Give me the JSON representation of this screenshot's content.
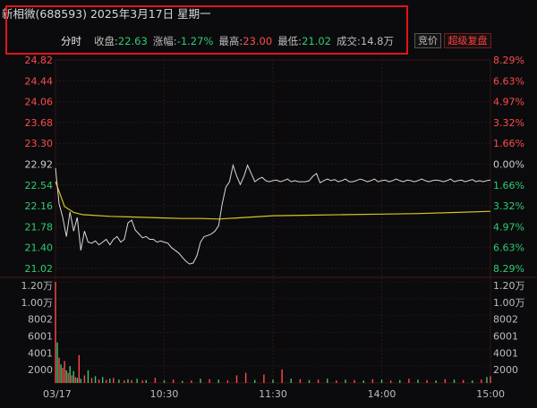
{
  "header": {
    "title": "新相微(688593) 2025年3月17日 星期一",
    "mode": "分时",
    "close_label": "收盘:",
    "close_value": "22.63",
    "change_label": "涨幅:",
    "change_value": "-1.27%",
    "high_label": "最高:",
    "high_value": "23.00",
    "low_label": "最低:",
    "low_value": "21.02",
    "volume_label": "成交:",
    "volume_value": "14.8万"
  },
  "buttons": {
    "bid_label": "竞价",
    "super_label": "超级复盘"
  },
  "colors": {
    "up": "#ff4b4b",
    "down": "#2ecc71",
    "price_line": "#d8d8d8",
    "avg_line": "#d7c51e",
    "highlight_box": "#e0141b"
  },
  "chart_data": {
    "type": "line",
    "price_axis": {
      "ticks": [
        "24.82",
        "24.44",
        "24.06",
        "23.68",
        "23.30",
        "22.92",
        "22.54",
        "22.16",
        "21.78",
        "21.40",
        "21.02"
      ],
      "ylim": [
        21.02,
        24.82
      ],
      "prev_close": 22.92
    },
    "pct_axis": {
      "ticks": [
        "8.29%",
        "6.63%",
        "4.97%",
        "3.32%",
        "1.66%",
        "0.00%",
        "1.66%",
        "3.32%",
        "4.97%",
        "6.63%",
        "8.29%"
      ]
    },
    "x_ticks": [
      "03/17",
      "10:30",
      "11:30",
      "14:00",
      "15:00"
    ],
    "price_series": {
      "x": [
        0,
        2,
        4,
        6,
        8,
        10,
        12,
        14,
        16,
        18,
        20,
        22,
        24,
        26,
        28,
        30,
        32,
        34,
        36,
        38,
        40,
        42,
        44,
        46,
        48,
        50,
        52,
        54,
        56,
        58,
        60,
        62,
        64,
        66,
        68,
        70,
        72,
        74,
        76,
        78,
        80,
        82,
        84,
        86,
        88,
        90,
        92,
        94,
        96,
        98,
        100,
        102,
        104,
        106,
        108,
        110,
        112,
        114,
        116,
        118,
        120,
        122,
        124,
        126,
        128,
        130,
        132,
        134,
        136,
        138,
        140,
        142,
        144,
        146,
        148,
        150,
        152,
        154,
        156,
        158,
        160,
        162,
        164,
        166,
        168,
        170,
        172,
        174,
        176,
        178,
        180,
        182,
        184,
        186,
        188,
        190,
        192,
        194,
        196,
        198,
        200,
        202,
        204,
        206,
        208,
        210,
        212,
        214,
        216,
        218,
        220,
        222,
        224,
        226,
        228,
        230,
        232,
        234,
        236,
        238,
        240
      ],
      "values": [
        22.85,
        22.2,
        21.95,
        21.6,
        22.05,
        21.7,
        21.95,
        21.35,
        21.7,
        21.5,
        21.48,
        21.52,
        21.45,
        21.5,
        21.55,
        21.45,
        21.55,
        21.6,
        21.5,
        21.55,
        21.85,
        21.9,
        21.72,
        21.65,
        21.58,
        21.6,
        21.55,
        21.55,
        21.5,
        21.52,
        21.5,
        21.48,
        21.4,
        21.35,
        21.3,
        21.22,
        21.15,
        21.1,
        21.12,
        21.25,
        21.5,
        21.6,
        21.62,
        21.65,
        21.7,
        21.8,
        22.2,
        22.5,
        22.6,
        22.9,
        22.7,
        22.55,
        22.7,
        22.9,
        22.75,
        22.6,
        22.65,
        22.68,
        22.62,
        22.6,
        22.62,
        22.63,
        22.6,
        22.62,
        22.65,
        22.6,
        22.62,
        22.6,
        22.6,
        22.6,
        22.62,
        22.7,
        22.75,
        22.58,
        22.62,
        22.65,
        22.62,
        22.64,
        22.6,
        22.62,
        22.65,
        22.6,
        22.6,
        22.62,
        22.65,
        22.63,
        22.6,
        22.62,
        22.65,
        22.6,
        22.62,
        22.63,
        22.6,
        22.62,
        22.65,
        22.62,
        22.6,
        22.63,
        22.62,
        22.6,
        22.62,
        22.65,
        22.62,
        22.6,
        22.62,
        22.63,
        22.62,
        22.6,
        22.62,
        22.65,
        22.6,
        22.62,
        22.63,
        22.6,
        22.62,
        22.64,
        22.6,
        22.62,
        22.6,
        22.62,
        22.63
      ]
    },
    "avg_series": {
      "x": [
        0,
        5,
        10,
        15,
        20,
        30,
        40,
        50,
        60,
        70,
        80,
        90,
        95,
        100,
        110,
        120,
        140,
        160,
        180,
        200,
        220,
        240
      ],
      "values": [
        22.6,
        22.15,
        22.04,
        22.0,
        21.99,
        21.97,
        21.96,
        21.95,
        21.94,
        21.93,
        21.93,
        21.92,
        21.93,
        21.94,
        21.96,
        21.98,
        21.99,
        22.0,
        22.01,
        22.02,
        22.04,
        22.06
      ]
    },
    "volume_axis": {
      "ticks": [
        "1.20万",
        "1.00万",
        "8002",
        "6001",
        "4001",
        "2000"
      ],
      "ylim": [
        0,
        12000
      ]
    },
    "volume_series": {
      "x": [
        0,
        1,
        2,
        3,
        4,
        5,
        6,
        7,
        8,
        9,
        10,
        11,
        12,
        13,
        14,
        16,
        18,
        20,
        22,
        24,
        26,
        28,
        30,
        32,
        35,
        38,
        40,
        42,
        45,
        48,
        50,
        55,
        60,
        65,
        70,
        75,
        80,
        85,
        90,
        95,
        100,
        105,
        110,
        115,
        120,
        125,
        130,
        135,
        140,
        145,
        150,
        155,
        160,
        165,
        170,
        175,
        180,
        185,
        190,
        195,
        200,
        205,
        210,
        215,
        220,
        225,
        230,
        235,
        238,
        240
      ],
      "values": [
        12000,
        4800,
        3000,
        2200,
        1800,
        2600,
        1500,
        1200,
        2000,
        900,
        1400,
        700,
        600,
        3300,
        500,
        900,
        1500,
        600,
        800,
        400,
        700,
        350,
        500,
        600,
        400,
        300,
        450,
        350,
        500,
        300,
        350,
        600,
        300,
        400,
        250,
        300,
        500,
        450,
        400,
        300,
        900,
        1200,
        350,
        1000,
        400,
        1600,
        500,
        450,
        350,
        400,
        500,
        300,
        400,
        350,
        300,
        450,
        400,
        300,
        350,
        500,
        400,
        350,
        300,
        450,
        400,
        350,
        300,
        400,
        700,
        800
      ],
      "directions": [
        "up",
        "down",
        "up",
        "down",
        "up",
        "up",
        "down",
        "up",
        "down",
        "up",
        "down",
        "up",
        "down",
        "up",
        "down",
        "up",
        "down",
        "up",
        "down",
        "up",
        "down",
        "up",
        "down",
        "up",
        "down",
        "up",
        "down",
        "up",
        "down",
        "up",
        "down",
        "up",
        "down",
        "up",
        "down",
        "up",
        "down",
        "up",
        "down",
        "up",
        "up",
        "up",
        "down",
        "up",
        "down",
        "up",
        "down",
        "up",
        "down",
        "up",
        "down",
        "up",
        "down",
        "up",
        "down",
        "up",
        "down",
        "up",
        "down",
        "up",
        "down",
        "up",
        "down",
        "up",
        "down",
        "up",
        "down",
        "up",
        "down",
        "up"
      ]
    }
  }
}
